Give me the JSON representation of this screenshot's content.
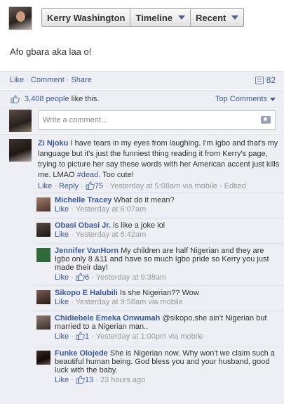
{
  "header": {
    "page_name": "Kerry Washington",
    "timeline_label": "Timeline",
    "recent_label": "Recent"
  },
  "post": {
    "text": "Afo gbara aka laa o!"
  },
  "actions": {
    "like": "Like",
    "comment": "Comment",
    "share": "Share",
    "sep": "·",
    "comment_count": "82"
  },
  "likes": {
    "people_link": "3,408 people",
    "suffix": " like this.",
    "top_comments": "Top Comments"
  },
  "write_comment": {
    "placeholder": "Write a comment..."
  },
  "comments": [
    {
      "name": "Zi Njoku",
      "text_before": " I have tears in my eyes from laughing. I'm Igbo and that's my language but it's just the funniest thing reading it from Kerry's page, trying to picture her say these words with her American accent just kills me. LMAO ",
      "hashtag": "#dead",
      "text_after": ". Too cute!",
      "like": "Like",
      "reply": "Reply",
      "likes": "75",
      "time": "Yesterday at 5:08am via mobile",
      "edited": "Edited"
    }
  ],
  "replies": [
    {
      "name": "Michelle Tracey",
      "text": " What do it mean?",
      "like": "Like",
      "likes": "",
      "time": "Yesterday at 6:07am"
    },
    {
      "name": "Obasi Obasi Jr.",
      "text": " is like a joke lol",
      "like": "Like",
      "likes": "",
      "time": "Yesterday at 6:42am"
    },
    {
      "name": "Jennifer VanHorn",
      "text": " My children are half Nigerian and they are Igbo only 8 &11 and have so much Igbo pride so Kerry you just made their day!",
      "like": "Like",
      "likes": "6",
      "time": "Yesterday at 9:38am"
    },
    {
      "name": "Sikopo E Halubili",
      "text": " Is she Nigerian?? Wow",
      "like": "Like",
      "likes": "",
      "time": "Yesterday at 9:58am via mobile"
    },
    {
      "name": "Chidiebele Emeka Onwumah",
      "text": " @sikopo,she ain't Nigerian but married to a Nigerian man..",
      "like": "Like",
      "likes": "1",
      "time": "Yesterday at 1:00pm via mobile"
    },
    {
      "name": "Funke Olojede",
      "text": " She is Nigerian now. Why won't we claim such a beautiful human being. God bless you and your husband, good luck with the baby.",
      "like": "Like",
      "likes": "13",
      "time": "23 hours ago"
    }
  ],
  "colors": {
    "link": "#3b5998",
    "feedback_bg": "#edeff4"
  }
}
